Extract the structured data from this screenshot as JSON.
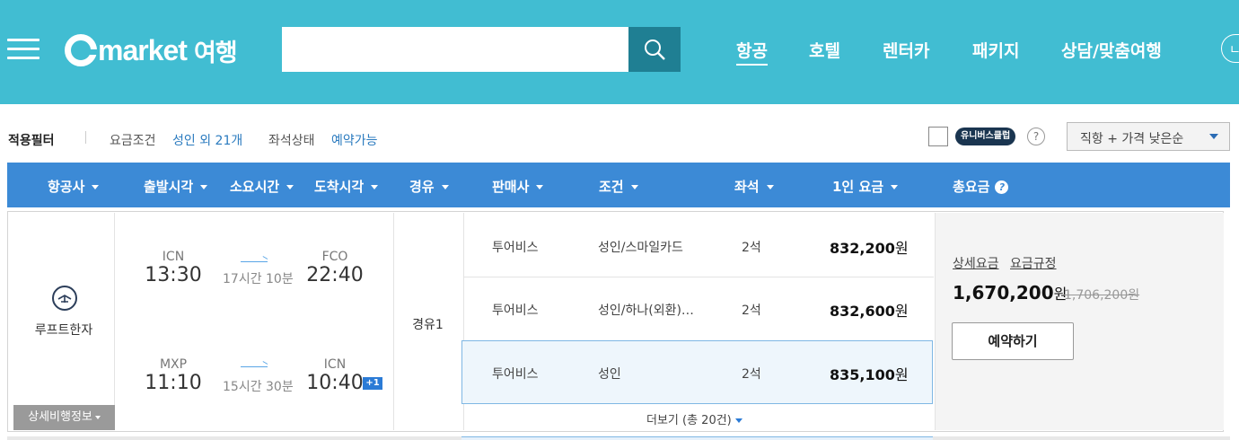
{
  "header": {
    "logo_text": "Gmarket 여행",
    "search": {
      "value": "",
      "placeholder": ""
    },
    "nav": [
      {
        "label": "항공",
        "active": true
      },
      {
        "label": "호텔"
      },
      {
        "label": "렌터카"
      },
      {
        "label": "패키지"
      },
      {
        "label": "상담/맞춤여행"
      }
    ],
    "login_partial": "ㄴ"
  },
  "filters": {
    "title": "적용필터",
    "fare_label": "요금조건",
    "fare_value": "성인 외 21개",
    "seat_label": "좌석상태",
    "seat_value": "예약가능",
    "universe_badge": "유니버스클럽",
    "help": "?",
    "sort_selected": "직항 + 가격 낮은순"
  },
  "table": {
    "columns": [
      "항공사",
      "출발시각",
      "소요시간",
      "도착시각",
      "경유",
      "판매사",
      "조건",
      "좌석",
      "1인 요금",
      "총요금"
    ]
  },
  "result": {
    "airline": "루프트한자",
    "detail_button": "상세비행정보",
    "outbound": {
      "from": "ICN",
      "dep": "13:30",
      "duration": "17시간 10분",
      "to": "FCO",
      "arr": "22:40"
    },
    "inbound": {
      "from": "MXP",
      "dep": "11:10",
      "duration": "15시간 30분",
      "to": "ICN",
      "arr": "10:40",
      "day_offset": "+1"
    },
    "stops": "경유1",
    "fares": [
      {
        "seller": "투어비스",
        "condition": "성인/스마일카드",
        "seats": "2석",
        "price": "832,200",
        "unit": "원"
      },
      {
        "seller": "투어비스",
        "condition": "성인/하나(외환)…",
        "seats": "2석",
        "price": "832,600",
        "unit": "원"
      },
      {
        "seller": "투어비스",
        "condition": "성인",
        "seats": "2석",
        "price": "835,100",
        "unit": "원"
      }
    ],
    "more_label": "더보기 (총 20건)",
    "detail_fare_link": "상세요금",
    "fare_rules_link": "요금규정",
    "total_price": "1,670,200",
    "total_unit": "원",
    "old_price": "1,706,200원",
    "book_button": "예약하기"
  },
  "colors": {
    "header_bg": "#41bdd2",
    "search_btn": "#1f7f93",
    "table_header": "#3c8ad6",
    "accent_text": "#2b7bbf"
  }
}
